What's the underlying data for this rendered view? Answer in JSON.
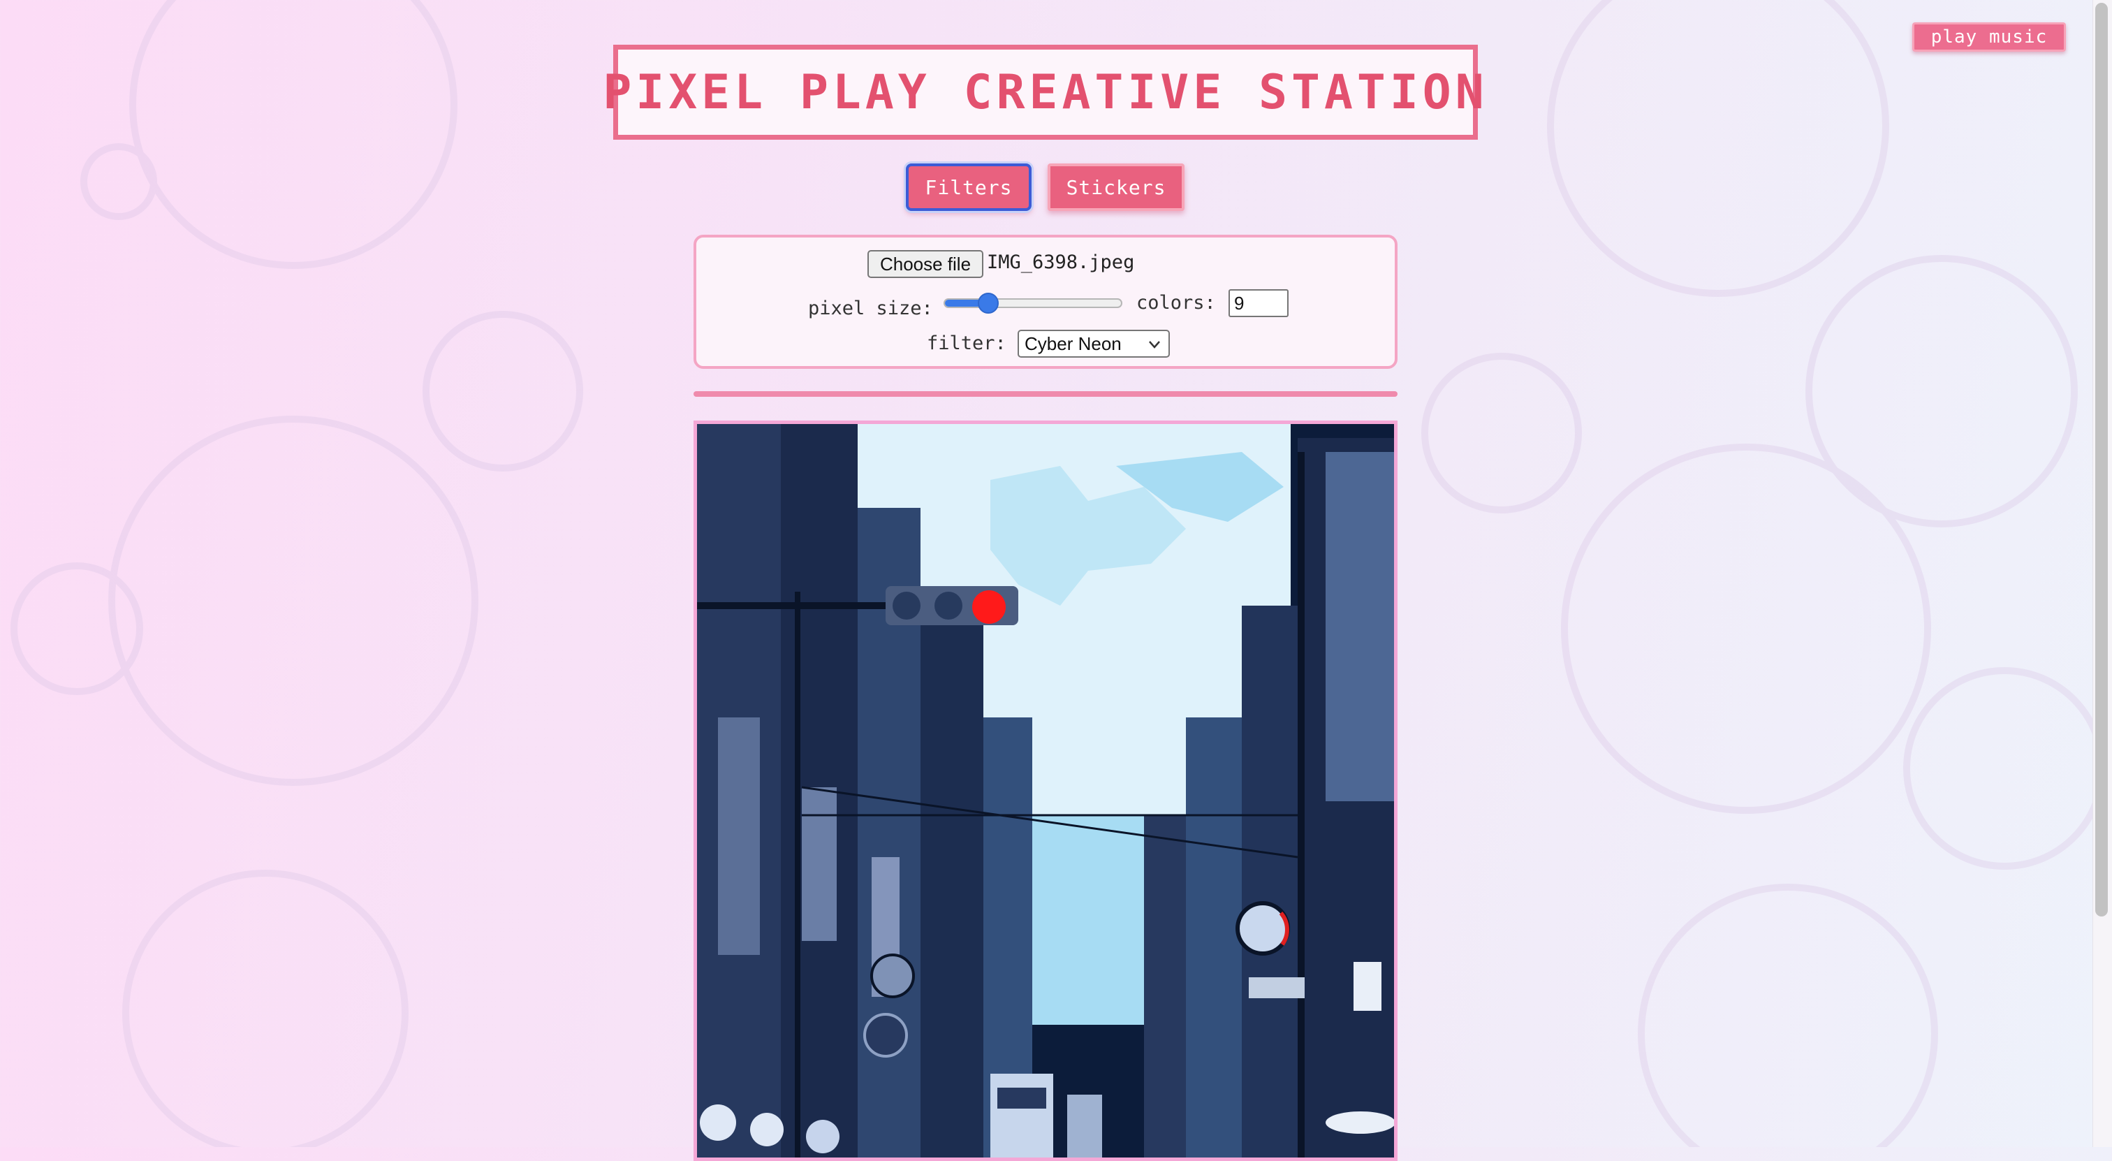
{
  "header": {
    "music_label": "play music",
    "title": "PIXEL PLAY CREATIVE STATION"
  },
  "tabs": [
    {
      "label": "Filters",
      "active": true
    },
    {
      "label": "Stickers",
      "active": false
    }
  ],
  "controls": {
    "choose_file_label": "Choose file",
    "file_name": "IMG_6398.jpeg",
    "pixel_size_label": "pixel size:",
    "pixel_size_level": 0.25,
    "colors_label": "colors:",
    "colors_value": "9",
    "filter_label": "filter:",
    "filter_value": "Cyber Neon"
  },
  "canvas": {
    "description_icon": "pixelated-street-image",
    "traffic_light_color": "#ff1a1a"
  },
  "colors": {
    "accent": "#e9617f",
    "title_border": "#ea6e8d",
    "active_outline": "#3c5bd6",
    "panel_border": "#f4a5c4",
    "divider": "#ef8aac",
    "slider": "#3a7ae8"
  }
}
